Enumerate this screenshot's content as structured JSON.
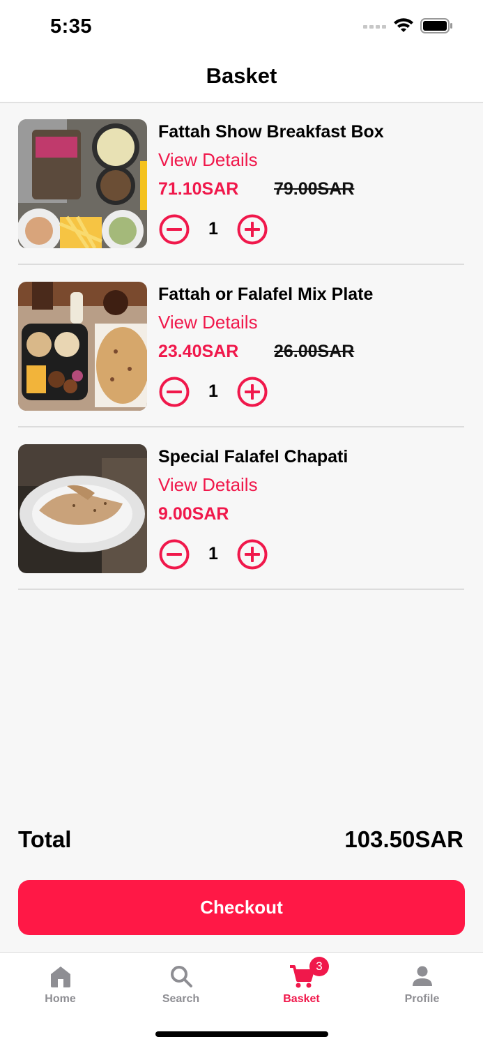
{
  "status_bar": {
    "time": "5:35"
  },
  "header": {
    "title": "Basket"
  },
  "items": [
    {
      "name": "Fattah Show Breakfast Box",
      "view_details": "View Details",
      "price": "71.10SAR",
      "old_price": "79.00SAR",
      "quantity": "1"
    },
    {
      "name": "Fattah or Falafel Mix Plate",
      "view_details": "View Details",
      "price": "23.40SAR",
      "old_price": "26.00SAR",
      "quantity": "1"
    },
    {
      "name": "Special Falafel Chapati",
      "view_details": "View Details",
      "price": "9.00SAR",
      "quantity": "1"
    }
  ],
  "total": {
    "label": "Total",
    "value": "103.50SAR"
  },
  "checkout": {
    "label": "Checkout"
  },
  "tabbar": {
    "tabs": [
      {
        "label": "Home",
        "icon": "home-icon"
      },
      {
        "label": "Search",
        "icon": "search-icon"
      },
      {
        "label": "Basket",
        "icon": "cart-icon",
        "badge": "3",
        "active": true
      },
      {
        "label": "Profile",
        "icon": "person-icon"
      }
    ]
  },
  "colors": {
    "accent": "#f0184b",
    "checkout": "#ff1846",
    "inactive": "#8e8e93"
  }
}
